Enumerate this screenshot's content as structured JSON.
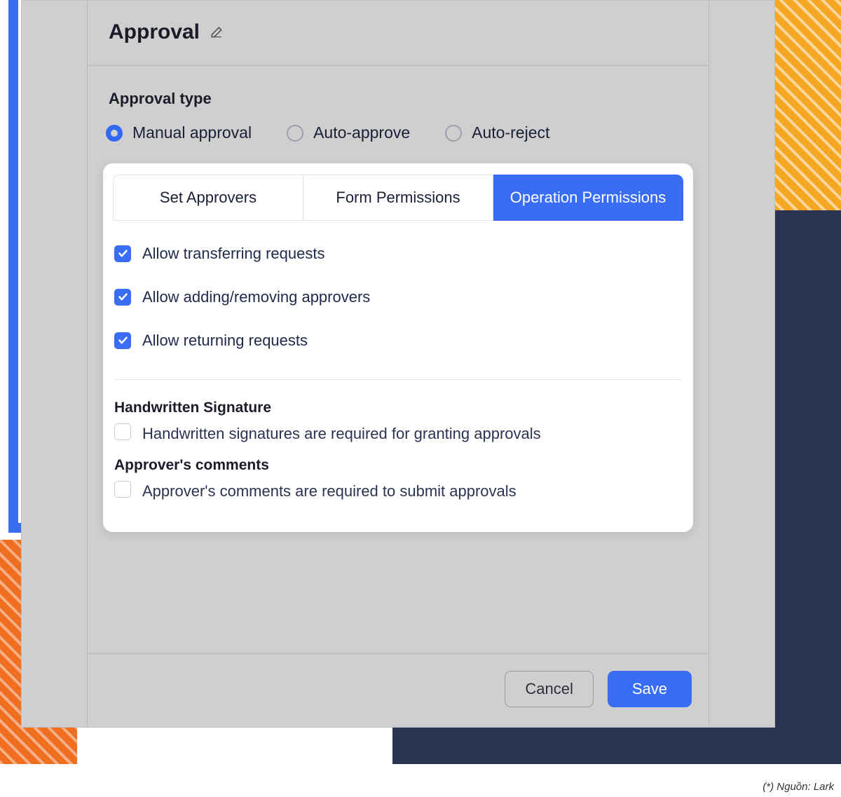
{
  "header": {
    "title": "Approval"
  },
  "approval_type": {
    "label": "Approval type",
    "options": [
      {
        "label": "Manual approval",
        "checked": true
      },
      {
        "label": "Auto-approve",
        "checked": false
      },
      {
        "label": "Auto-reject",
        "checked": false
      }
    ]
  },
  "tabs": [
    {
      "label": "Set Approvers",
      "active": false
    },
    {
      "label": "Form Permissions",
      "active": false
    },
    {
      "label": "Operation Permissions",
      "active": true
    }
  ],
  "permissions": [
    {
      "label": "Allow transferring requests",
      "checked": true
    },
    {
      "label": "Allow adding/removing approvers",
      "checked": true
    },
    {
      "label": "Allow returning requests",
      "checked": true
    }
  ],
  "signature": {
    "title": "Handwritten Signature",
    "option_label": "Handwritten signatures are required for granting approvals",
    "checked": false
  },
  "comments": {
    "title": "Approver's comments",
    "option_label": "Approver's comments are required to submit approvals",
    "checked": false
  },
  "footer": {
    "cancel": "Cancel",
    "save": "Save"
  },
  "credit": "(*) Nguồn: Lark"
}
